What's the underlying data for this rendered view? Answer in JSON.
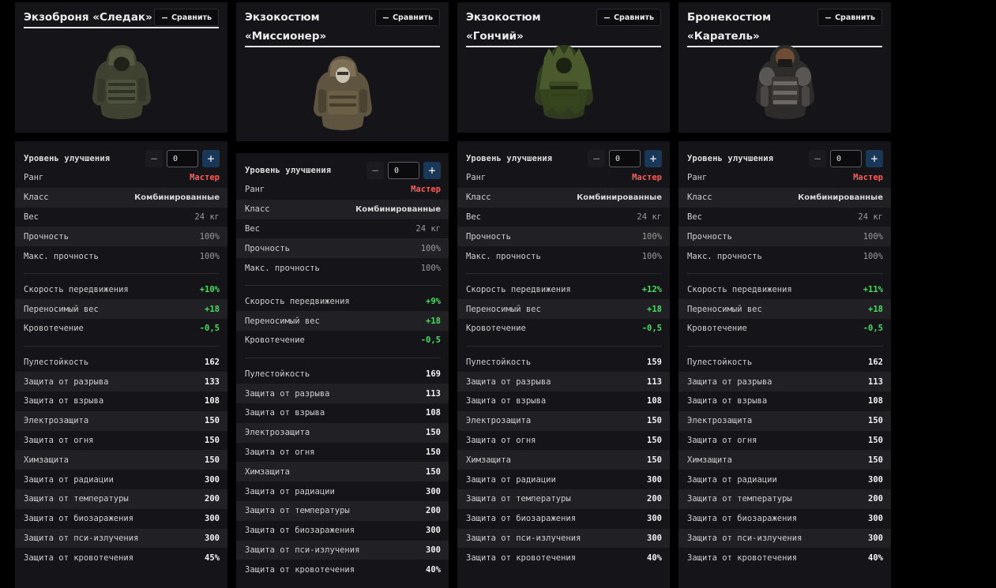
{
  "labels": {
    "compare": "Сравнить",
    "upgrade_level": "Уровень улучшения",
    "upgrade_value": "0",
    "rank": "Ранг",
    "class": "Класс",
    "weight": "Вес",
    "durability": "Прочность",
    "max_durability": "Макс. прочность",
    "speed": "Скорость передвижения",
    "carry_weight": "Переносимый вес",
    "bleeding": "Кровотечение",
    "bullet_res": "Пулестойкость",
    "tear_prot": "Защита от разрыва",
    "explosion_prot": "Защита от взрыва",
    "electro_prot": "Электрозащита",
    "fire_prot": "Защита от огня",
    "chem_prot": "Химзащита",
    "rad_prot": "Защита от радиации",
    "temp_prot": "Защита от температуры",
    "bio_prot": "Защита от биозаражения",
    "psi_prot": "Защита от пси-излучения",
    "bleed_prot": "Защита от кровотечения"
  },
  "colors": {
    "background": "#000000",
    "panel": "#151519",
    "row_alt": "#202025",
    "rank_red": "#ff5a5a",
    "bonus_green": "#4cd964",
    "plus_button": "#1a3757"
  },
  "items": [
    {
      "title": "Экзоброня «Следак»",
      "rank": "Мастер",
      "class": "Комбинированные",
      "weight": "24 кг",
      "durability": "100%",
      "max_durability": "100%",
      "speed": "+10%",
      "carry_weight": "+18",
      "bleeding": "-0,5",
      "bullet_res": "162",
      "tear_prot": "133",
      "explosion_prot": "108",
      "electro_prot": "150",
      "fire_prot": "150",
      "chem_prot": "150",
      "rad_prot": "300",
      "temp_prot": "200",
      "bio_prot": "300",
      "psi_prot": "300",
      "bleed_prot": "45%"
    },
    {
      "title": "Экзокостюм «Миссионер»",
      "rank": "Мастер",
      "class": "Комбинированные",
      "weight": "24 кг",
      "durability": "100%",
      "max_durability": "100%",
      "speed": "+9%",
      "carry_weight": "+18",
      "bleeding": "-0,5",
      "bullet_res": "169",
      "tear_prot": "113",
      "explosion_prot": "108",
      "electro_prot": "150",
      "fire_prot": "150",
      "chem_prot": "150",
      "rad_prot": "300",
      "temp_prot": "200",
      "bio_prot": "300",
      "psi_prot": "300",
      "bleed_prot": "40%"
    },
    {
      "title": "Экзокостюм «Гончий»",
      "rank": "Мастер",
      "class": "Комбинированные",
      "weight": "24 кг",
      "durability": "100%",
      "max_durability": "100%",
      "speed": "+12%",
      "carry_weight": "+18",
      "bleeding": "-0,5",
      "bullet_res": "159",
      "tear_prot": "113",
      "explosion_prot": "108",
      "electro_prot": "150",
      "fire_prot": "150",
      "chem_prot": "150",
      "rad_prot": "300",
      "temp_prot": "200",
      "bio_prot": "300",
      "psi_prot": "300",
      "bleed_prot": "40%"
    },
    {
      "title": "Бронекостюм «Каратель»",
      "rank": "Мастер",
      "class": "Комбинированные",
      "weight": "24 кг",
      "durability": "100%",
      "max_durability": "100%",
      "speed": "+11%",
      "carry_weight": "+18",
      "bleeding": "-0,5",
      "bullet_res": "162",
      "tear_prot": "113",
      "explosion_prot": "108",
      "electro_prot": "150",
      "fire_prot": "150",
      "chem_prot": "150",
      "rad_prot": "300",
      "temp_prot": "200",
      "bio_prot": "300",
      "psi_prot": "300",
      "bleed_prot": "40%"
    }
  ]
}
